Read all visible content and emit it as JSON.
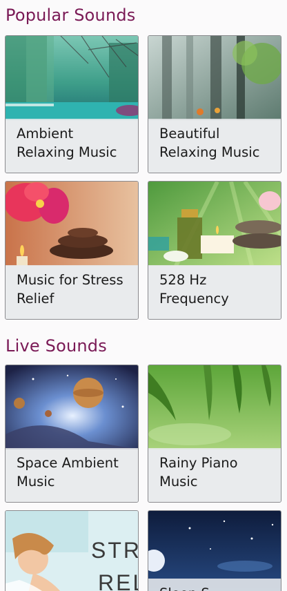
{
  "sections": [
    {
      "title": "Popular Sounds",
      "cards": [
        {
          "label": "Ambient Relaxing Music",
          "image": "forest-lake-image"
        },
        {
          "label": "Beautiful Relaxing Music",
          "image": "misty-forest-image"
        },
        {
          "label": "Music for Stress Relief",
          "image": "orchid-stones-candle-image"
        },
        {
          "label": "528 Hz Frequency",
          "image": "spa-oil-candle-image"
        }
      ]
    },
    {
      "title": "Live Sounds",
      "cards": [
        {
          "label": "Space Ambient Music",
          "image": "space-planets-image"
        },
        {
          "label": "Rainy Piano Music",
          "image": "green-leaves-image"
        },
        {
          "label": "",
          "image": "stress-relief-girl-image",
          "overlay_text_1": "STR",
          "overlay_text_2": "REL"
        },
        {
          "label": "Sleep S",
          "image": "night-sky-moon-image"
        }
      ]
    }
  ],
  "colors": {
    "accent": "#7a1a56",
    "card_label_bg": "#e8eaed",
    "card_border": "#8a8a8e"
  }
}
